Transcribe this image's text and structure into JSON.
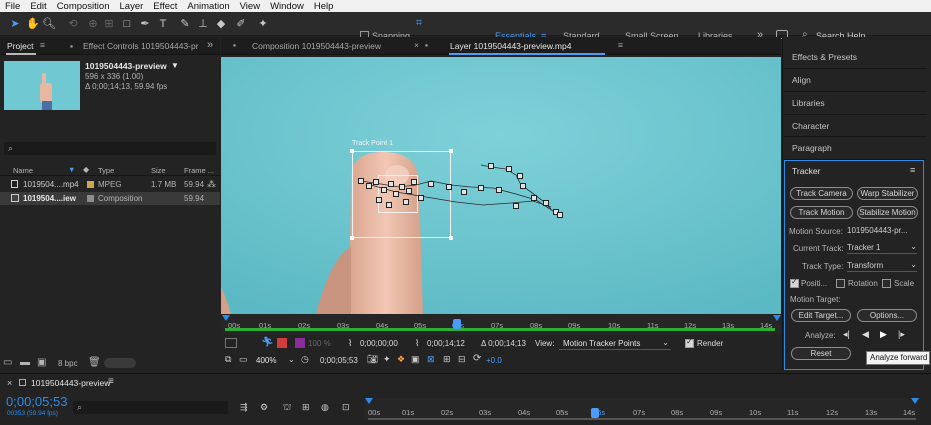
{
  "menu": [
    "File",
    "Edit",
    "Composition",
    "Layer",
    "Effect",
    "Animation",
    "View",
    "Window",
    "Help"
  ],
  "toolbar": {
    "snapping_label": "Snapping",
    "workspaces": [
      "Essentials",
      "Standard",
      "Small Screen",
      "Libraries"
    ],
    "search_placeholder": "Search Help"
  },
  "project_panel": {
    "tabs": [
      "Project",
      "Effect Controls 1019504443-pr"
    ],
    "selected_name": "1019504443-preview",
    "selected_dims": "596 x 336 (1.00)",
    "selected_duration": "Δ 0;00;14;13, 59.94 fps",
    "columns": [
      "Name",
      "Type",
      "Size",
      "Frame ..."
    ],
    "rows": [
      {
        "name": "1019504....mp4",
        "type": "MPEG",
        "size": "1.7 MB",
        "fps": "59.94"
      },
      {
        "name": "1019504....iew",
        "type": "Composition",
        "size": "",
        "fps": "59.94"
      }
    ],
    "bpc": "8 bpc"
  },
  "viewer": {
    "tabs": [
      "Composition 1019504443-preview",
      "Layer 1019504443-preview.mp4"
    ],
    "track_point_label": "Track Point 1",
    "ruler_ticks": [
      "00s",
      "01s",
      "02s",
      "03s",
      "04s",
      "05s",
      "06s",
      "07s",
      "08s",
      "09s",
      "10s",
      "11s",
      "12s",
      "13s",
      "14s"
    ],
    "timecode_start": "0;00;00;00",
    "timecode_end": "0;00;14;12",
    "timecode_duration": "Δ 0;00;14;13",
    "view_label": "View:",
    "view_value": "Motion Tracker Points",
    "render_label": "Render",
    "zoom": "400%",
    "current_time": "0;00;05;53",
    "exposure": "+0.0",
    "opacity": "100 %"
  },
  "right_panel": {
    "sections": [
      "Effects & Presets",
      "Align",
      "Libraries",
      "Character",
      "Paragraph"
    ],
    "tracker": {
      "title": "Tracker",
      "btn_track_camera": "Track Camera",
      "btn_warp_stabilizer": "Warp Stabilizer",
      "btn_track_motion": "Track Motion",
      "btn_stabilize_motion": "Stabilize Motion",
      "motion_source_label": "Motion Source:",
      "motion_source_value": "1019504443-pr...",
      "current_track_label": "Current Track:",
      "current_track_value": "Tracker 1",
      "track_type_label": "Track Type:",
      "track_type_value": "Transform",
      "position_label": "Positi...",
      "rotation_label": "Rotation",
      "scale_label": "Scale",
      "motion_target_label": "Motion Target:",
      "btn_edit_target": "Edit Target...",
      "btn_options": "Options...",
      "analyze_label": "Analyze:",
      "btn_reset": "Reset",
      "tooltip": "Analyze forward"
    }
  },
  "timeline": {
    "comp_name": "1019504443-preview",
    "timecode": "0;00;05;53",
    "frames": "00353 (59.94 fps)",
    "ruler_ticks": [
      "00s",
      "01s",
      "02s",
      "03s",
      "04s",
      "05s",
      "06s",
      "07s",
      "08s",
      "09s",
      "10s",
      "11s",
      "12s",
      "13s",
      "14s"
    ]
  },
  "colors": {
    "accent": "#2d8ceb",
    "viewer_bg": "#6cc6cf",
    "panel_bg": "#232323",
    "label_red": "#d43b3b",
    "label_purple": "#8a2c9a"
  }
}
